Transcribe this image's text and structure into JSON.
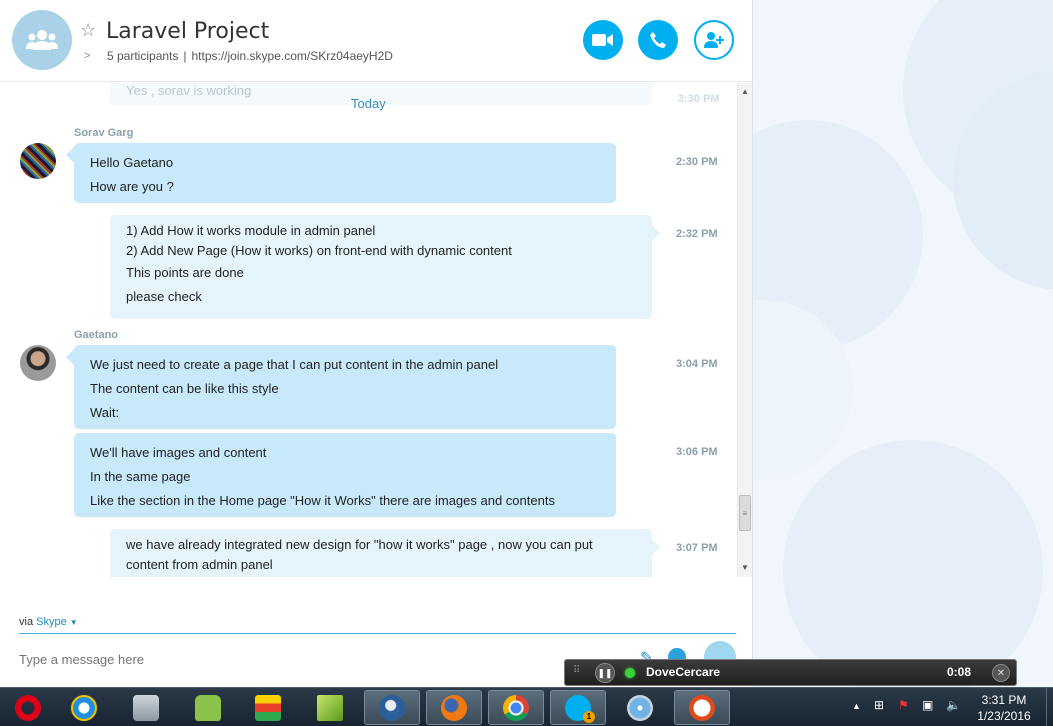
{
  "conversation": {
    "title": "Laravel Project",
    "participants": "5 participants",
    "separator": "|",
    "link": "https://join.skype.com/SKrz04aeyH2D"
  },
  "header_buttons": {
    "video_icon": "video-camera-icon",
    "call_icon": "phone-icon",
    "add_icon": "add-person-icon"
  },
  "messages": {
    "ghost_text": "Yes , sorav is working",
    "ghost_time": "3:30 PM",
    "day_label": "Today",
    "groups": [
      {
        "sender": "Sorav Garg",
        "items": [
          {
            "lines": [
              "Hello Gaetano",
              "How are you ?"
            ],
            "time": "2:30 PM"
          },
          {
            "lines": [
              "1) Add How it works module in admin panel",
              "2) Add New Page (How it works)  on front-end with dynamic content",
              "This points are done",
              "please check"
            ],
            "time": "2:32 PM"
          }
        ]
      },
      {
        "sender": "Gaetano",
        "items": [
          {
            "lines": [
              "We just need to create a page that I can put content in the admin panel",
              "The content can be like this style",
              "Wait:"
            ],
            "time": "3:04 PM"
          },
          {
            "lines": [
              "We'll have images and content",
              "In the same page",
              "Like the section in the Home page \"How it Works\" there are images and contents"
            ],
            "time": "3:06 PM"
          },
          {
            "lines": [
              "we have already integrated new design for \"how it works\" page , now you can put",
              "content from admin panel"
            ],
            "time": "3:07 PM"
          }
        ]
      }
    ]
  },
  "composer": {
    "via_label": "via",
    "via_service": "Skype",
    "placeholder": "Type a message here"
  },
  "recording_bar": {
    "name": "DoveCercare",
    "timer": "0:08"
  },
  "taskbar": {
    "apps": [
      "opera-icon",
      "internet-explorer-icon",
      "vlc-icon",
      "android-icon",
      "bluestacks-icon",
      "fl-studio-icon",
      "thunderbird-icon",
      "firefox-icon",
      "chrome-icon",
      "skype-icon",
      "safari-icon",
      "task-app-icon"
    ],
    "skype_badge": "1",
    "clock_time": "3:31 PM",
    "clock_date": "1/23/2016"
  },
  "colors": {
    "accent": "#00aff0",
    "incoming_bubble": "#c7e9f9",
    "outgoing_bubble": "#e5f4fb"
  }
}
